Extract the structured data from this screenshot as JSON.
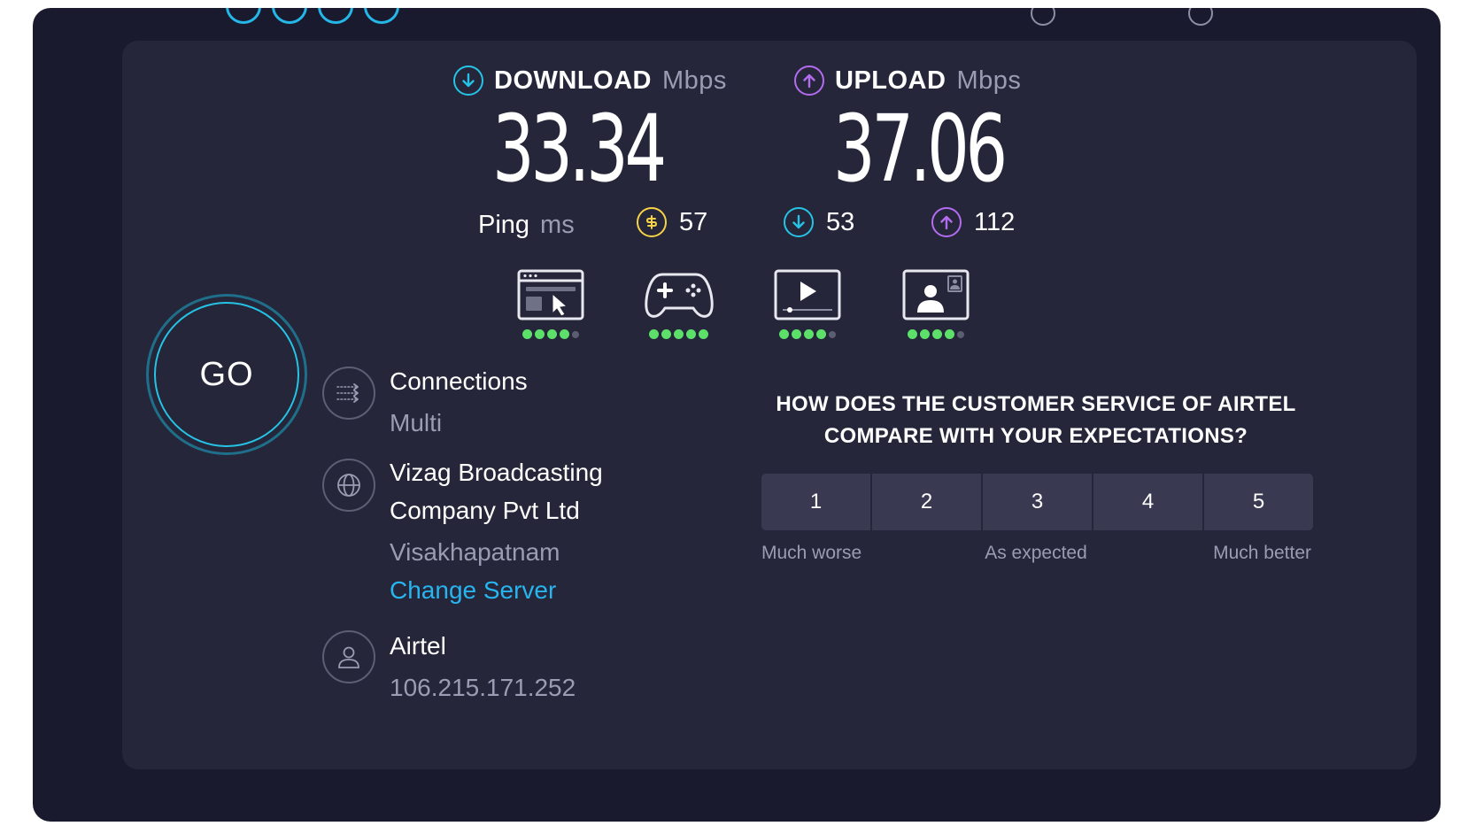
{
  "download": {
    "label": "DOWNLOAD",
    "unit": "Mbps",
    "value": "33.34"
  },
  "upload": {
    "label": "UPLOAD",
    "unit": "Mbps",
    "value": "37.06"
  },
  "ping": {
    "label": "Ping",
    "unit": "ms",
    "idle": "57",
    "download": "53",
    "upload": "112"
  },
  "app_ratings": [
    {
      "icon": "web-browsing-icon",
      "rating": 4,
      "max": 5
    },
    {
      "icon": "gaming-controller-icon",
      "rating": 5,
      "max": 5
    },
    {
      "icon": "video-streaming-icon",
      "rating": 4,
      "max": 5
    },
    {
      "icon": "video-call-icon",
      "rating": 4,
      "max": 5
    }
  ],
  "go_button": "GO",
  "connections": {
    "title": "Connections",
    "value": "Multi"
  },
  "server": {
    "name_line1": "Vizag Broadcasting",
    "name_line2": "Company Pvt Ltd",
    "location": "Visakhapatnam",
    "change_label": "Change Server"
  },
  "provider": {
    "name": "Airtel",
    "ip": "106.215.171.252"
  },
  "survey": {
    "question_line1": "HOW DOES THE CUSTOMER SERVICE OF AIRTEL",
    "question_line2": "COMPARE WITH YOUR EXPECTATIONS?",
    "options": [
      "1",
      "2",
      "3",
      "4",
      "5"
    ],
    "low_label": "Much worse",
    "mid_label": "As expected",
    "high_label": "Much better"
  },
  "colors": {
    "background": "#1a1a2e",
    "panel": "#252639",
    "accent": "#25c4e6",
    "download": "#25c4e6",
    "upload": "#b36cf0",
    "ping": "#f5d246",
    "good": "#5ce06a"
  }
}
